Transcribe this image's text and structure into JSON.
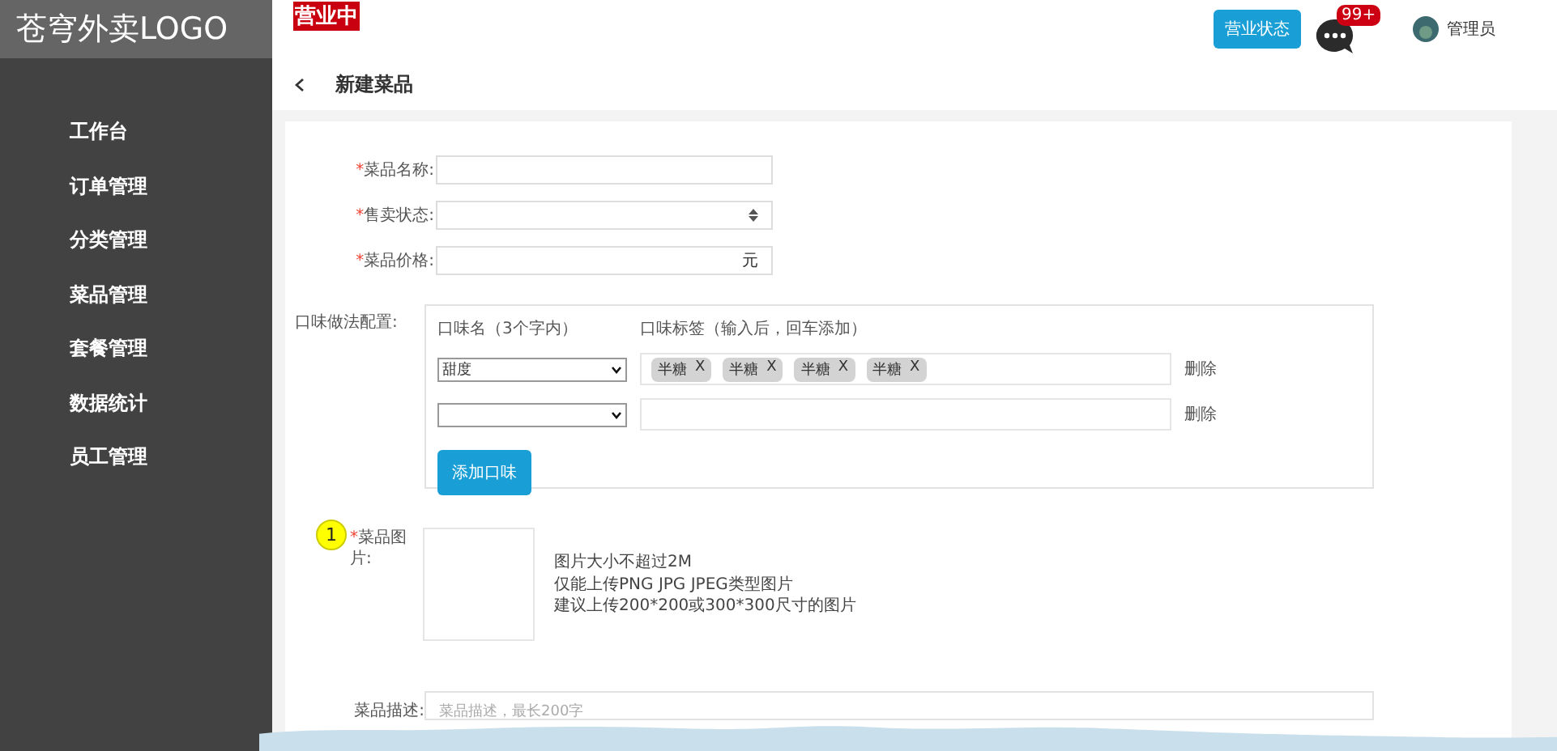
{
  "sidebar": {
    "logo": "苍穹外卖LOGO",
    "items": [
      {
        "label": "工作台"
      },
      {
        "label": "订单管理"
      },
      {
        "label": "分类管理"
      },
      {
        "label": "菜品管理"
      },
      {
        "label": "套餐管理"
      },
      {
        "label": "数据统计"
      },
      {
        "label": "员工管理"
      }
    ]
  },
  "header": {
    "status_badge": "营业中",
    "status_button": "营业状态",
    "message_count": "99+",
    "user": "管理员"
  },
  "page": {
    "title": "新建菜品"
  },
  "form": {
    "fields": [
      {
        "mark": "*",
        "label": "菜品名称:",
        "kind": "text"
      },
      {
        "mark": "*",
        "label": "售卖状态:",
        "kind": "select"
      },
      {
        "mark": "*",
        "label": "菜品价格:",
        "kind": "price",
        "suffix": "元"
      }
    ],
    "flavors": {
      "label": "口味做法配置:",
      "name_header": "口味名（3个字内）",
      "tags_header": "口味标签（输入后，回车添加）",
      "rows": [
        {
          "name": "甜度",
          "tags": [
            {
              "text": "半糖",
              "close": "X"
            },
            {
              "text": "半糖",
              "close": "X"
            },
            {
              "text": "半糖",
              "close": "X"
            },
            {
              "text": "半糖",
              "close": "X"
            }
          ],
          "delete": "删除"
        },
        {
          "delete": "删除"
        }
      ],
      "add_button": "添加口味"
    },
    "image": {
      "annotation": "1",
      "mark": "*",
      "label": "菜品图片:",
      "hints": [
        "图片大小不超过2M",
        "仅能上传PNG JPG JPEG类型图片",
        "建议上传200*200或300*300尺寸的图片"
      ]
    },
    "description": {
      "label": "菜品描述:",
      "placeholder": "菜品描述，最长200字"
    }
  }
}
